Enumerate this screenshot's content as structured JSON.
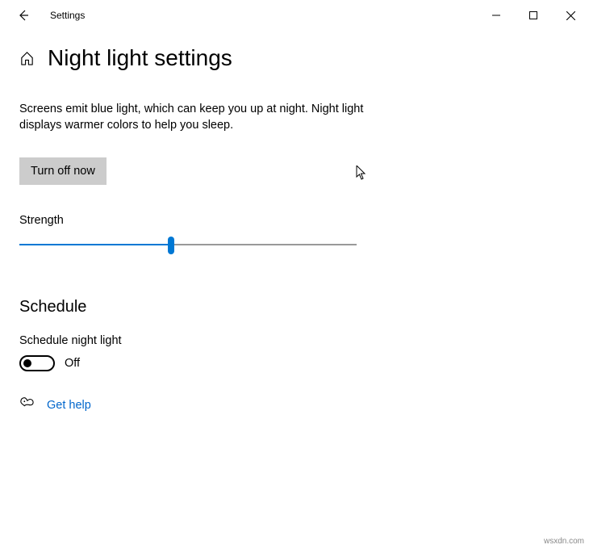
{
  "titlebar": {
    "app_name": "Settings"
  },
  "header": {
    "title": "Night light settings"
  },
  "main": {
    "description": "Screens emit blue light, which can keep you up at night. Night light displays warmer colors to help you sleep.",
    "turn_off_label": "Turn off now",
    "strength_label": "Strength",
    "strength_value": 45
  },
  "schedule": {
    "heading": "Schedule",
    "toggle_label": "Schedule night light",
    "toggle_state": "Off",
    "toggle_on": false
  },
  "help": {
    "link_label": "Get help"
  },
  "watermark": "wsxdn.com"
}
